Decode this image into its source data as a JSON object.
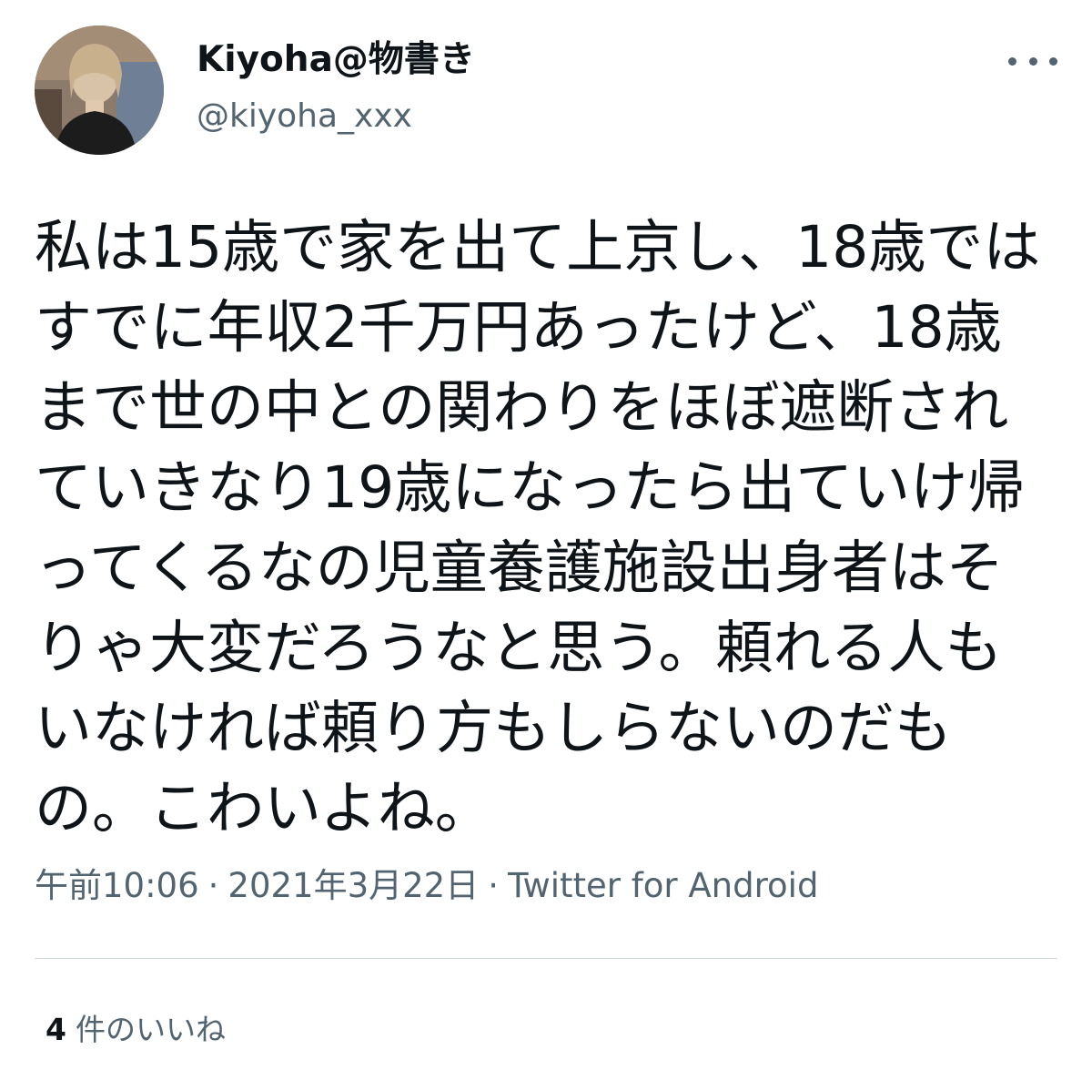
{
  "user": {
    "display_name": "Kiyoha@物書き",
    "handle": "@kiyoha_xxx"
  },
  "tweet": {
    "lines": [
      "私は15歳で家を出て上京し、18歳では",
      "すでに年収2千万円あったけど、18歳",
      "まで世の中との関わりをほぼ遮断され",
      "ていきなり19歳になったら出ていけ帰",
      "ってくるなの児童養護施設出身者はそ",
      "りゃ大変だろうなと思う。頼れる人も",
      "いなければ頼り方もしらないのだも",
      "の。こわいよね。"
    ]
  },
  "meta": {
    "time": "午前10:06",
    "separator": "·",
    "date": "2021年3月22日",
    "client": "Twitter for Android"
  },
  "likes": {
    "count": "4",
    "label": "件のいいね"
  },
  "icons": {
    "more": "more-horizontal-icon",
    "avatar": "profile-photo"
  },
  "colors": {
    "text_primary": "#0f1419",
    "text_secondary": "#536471",
    "divider": "#cfd9de"
  }
}
